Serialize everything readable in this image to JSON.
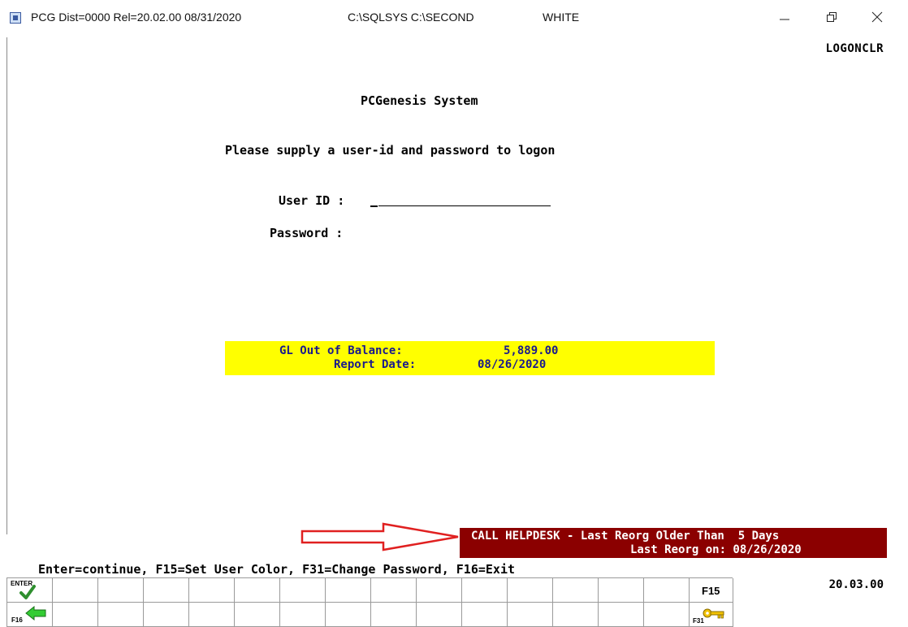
{
  "window": {
    "title_parts": [
      "PCG Dist=0000  Rel=20.02.00  08/31/2020",
      "C:\\SQLSYS  C:\\SECOND",
      "WHITE"
    ],
    "icons": [
      "app-icon",
      "minimize-icon",
      "restore-icon",
      "close-icon"
    ]
  },
  "screen": {
    "id": "LOGONCLR",
    "system_title": "PCGenesis System",
    "instruction": "Please supply a user-id and password to logon",
    "user_id_label": "User ID :",
    "user_id_value": "",
    "password_label": "Password :",
    "password_value": ""
  },
  "gl_notice": {
    "label1": "GL Out of Balance:",
    "value1": "5,889.00",
    "label2": "Report Date:",
    "value2": "08/26/2020",
    "background": "#ffff00",
    "text_color": "#1a1a8c"
  },
  "helpdesk": {
    "line1": "CALL HELPDESK - Last Reorg Older Than  5 Days",
    "line2": "Last Reorg on: 08/26/2020",
    "background": "#8b0000",
    "arrow_color": "#e02020"
  },
  "footer": {
    "instructions": "Enter=continue, F15=Set User Color, F31=Change Password, F16=Exit",
    "version": "20.03.00"
  },
  "function_keys": {
    "enter_label": "ENTER",
    "f16_label": "F16",
    "f15_label": "F15",
    "f31_label": "F31",
    "icons": [
      "checkmark-icon",
      "back-arrow-icon",
      "key-icon"
    ]
  }
}
